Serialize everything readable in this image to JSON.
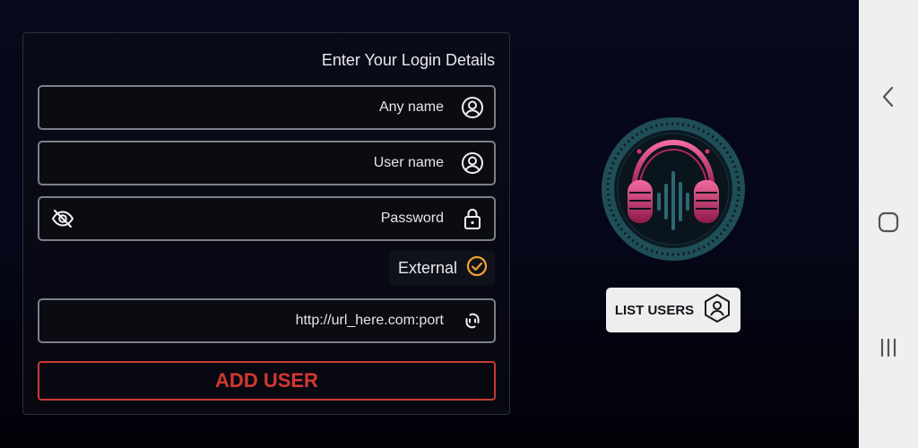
{
  "form": {
    "title": "Enter Your Login Details",
    "any_name_placeholder": "Any name",
    "user_name_placeholder": "User name",
    "password_placeholder": "Password",
    "external_label": "External",
    "external_checked": true,
    "url_placeholder": "http://url_here.com:port",
    "add_user_label": "ADD USER"
  },
  "side": {
    "list_users_label": "LIST USERS"
  },
  "icons": {
    "user": "user-circle-icon",
    "lock": "lock-icon",
    "eye_off": "eye-off-icon",
    "check": "check-circle-icon",
    "link": "link-icon",
    "logo": "headphones-logo",
    "list_users": "user-shield-icon",
    "back": "back-chevron-icon",
    "home": "home-icon",
    "recents": "recents-icon"
  },
  "colors": {
    "accent_red": "#d2382f",
    "check_orange": "#f0a132",
    "logo_pink": "#d6336c",
    "logo_teal": "#1f4e57"
  }
}
